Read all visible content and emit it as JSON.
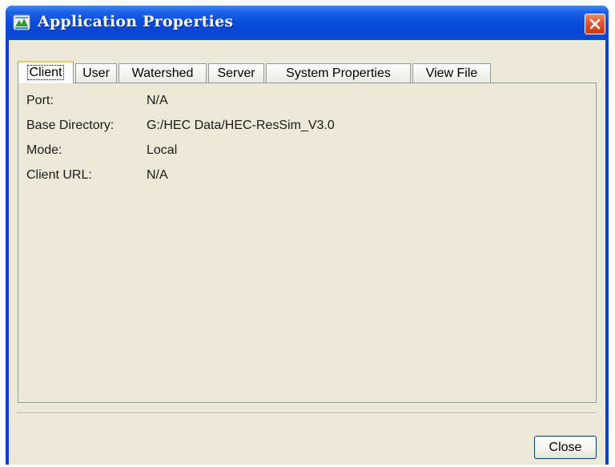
{
  "window": {
    "title": "Application Properties",
    "app_icon": "hec-app-icon",
    "close_icon": "close-icon"
  },
  "tabs": [
    {
      "label": "Client",
      "active": true
    },
    {
      "label": "User",
      "active": false
    },
    {
      "label": "Watershed",
      "active": false
    },
    {
      "label": "Server",
      "active": false
    },
    {
      "label": "System Properties",
      "active": false
    },
    {
      "label": "View File",
      "active": false
    }
  ],
  "client": {
    "port": {
      "label": "Port:",
      "value": "N/A"
    },
    "base_directory": {
      "label": "Base Directory:",
      "value": "G:/HEC Data/HEC-ResSim_V3.0"
    },
    "mode": {
      "label": "Mode:",
      "value": "Local"
    },
    "client_url": {
      "label": "Client URL:",
      "value": "N/A"
    }
  },
  "footer": {
    "close_label": "Close"
  },
  "colors": {
    "titlebar": "#0a4fdc",
    "dialog_bg": "#ece9d8",
    "active_tab_accent": "#ffc83c",
    "close_button_red": "#e2532e"
  }
}
